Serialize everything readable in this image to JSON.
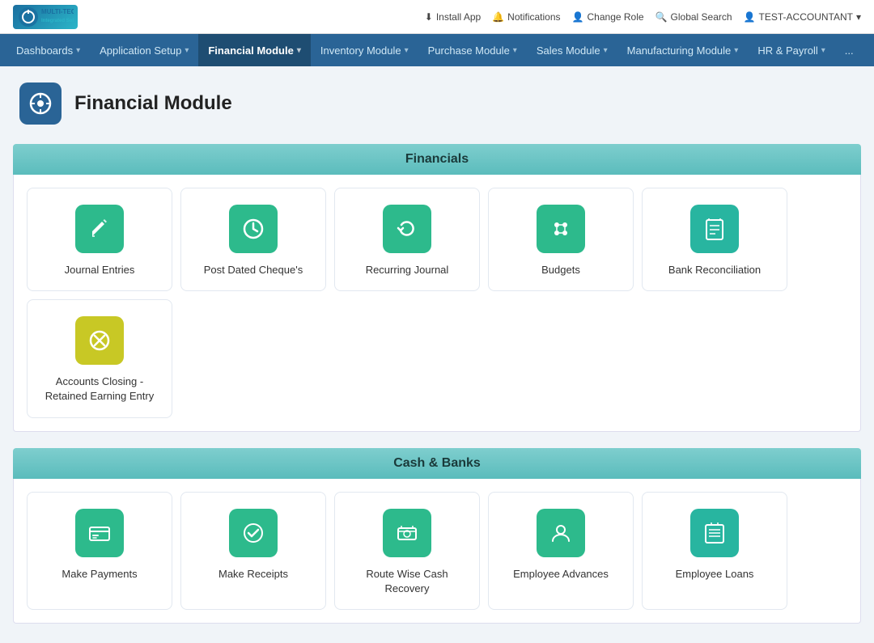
{
  "topbar": {
    "logo_text": "MULTI-TECHNO\nIntegrated Solutions",
    "actions": [
      {
        "id": "install-app",
        "label": "Install App",
        "icon": "⬇"
      },
      {
        "id": "notifications",
        "label": "Notifications",
        "icon": "🔔"
      },
      {
        "id": "change-role",
        "label": "Change Role",
        "icon": "👤"
      },
      {
        "id": "global-search",
        "label": "Global Search",
        "icon": "🔍"
      },
      {
        "id": "user",
        "label": "TEST-ACCOUNTANT",
        "icon": "👤"
      }
    ]
  },
  "navbar": {
    "items": [
      {
        "id": "dashboards",
        "label": "Dashboards",
        "active": false
      },
      {
        "id": "application-setup",
        "label": "Application Setup",
        "active": false
      },
      {
        "id": "financial-module",
        "label": "Financial Module",
        "active": true
      },
      {
        "id": "inventory-module",
        "label": "Inventory Module",
        "active": false
      },
      {
        "id": "purchase-module",
        "label": "Purchase Module",
        "active": false
      },
      {
        "id": "sales-module",
        "label": "Sales Module",
        "active": false
      },
      {
        "id": "manufacturing-module",
        "label": "Manufacturing Module",
        "active": false
      },
      {
        "id": "hr-payroll",
        "label": "HR & Payroll",
        "active": false
      },
      {
        "id": "more",
        "label": "...",
        "active": false
      }
    ]
  },
  "page": {
    "title": "Financial Module",
    "icon": "⚙"
  },
  "sections": [
    {
      "id": "financials",
      "label": "Financials",
      "cards": [
        {
          "id": "journal-entries",
          "label": "Journal Entries",
          "icon": "✏",
          "icon_class": "icon-teal"
        },
        {
          "id": "post-dated-cheques",
          "label": "Post Dated Cheque's",
          "icon": "🕐",
          "icon_class": "icon-teal"
        },
        {
          "id": "recurring-journal",
          "label": "Recurring Journal",
          "icon": "♻",
          "icon_class": "icon-teal"
        },
        {
          "id": "budgets",
          "label": "Budgets",
          "icon": "⚏",
          "icon_class": "icon-teal"
        },
        {
          "id": "bank-reconciliation",
          "label": "Bank Reconciliation",
          "icon": "📄",
          "icon_class": "icon-green-teal"
        },
        {
          "id": "accounts-closing",
          "label": "Accounts Closing - Retained Earning Entry",
          "icon": "⊗",
          "icon_class": "icon-yellow"
        }
      ]
    },
    {
      "id": "cash-banks",
      "label": "Cash & Banks",
      "cards": [
        {
          "id": "make-payments",
          "label": "Make Payments",
          "icon": "💳",
          "icon_class": "icon-teal"
        },
        {
          "id": "make-receipts",
          "label": "Make Receipts",
          "icon": "✅",
          "icon_class": "icon-teal"
        },
        {
          "id": "route-wise-cash-recovery",
          "label": "Route Wise Cash Recovery",
          "icon": "💵",
          "icon_class": "icon-teal"
        },
        {
          "id": "employee-advances",
          "label": "Employee Advances",
          "icon": "👤",
          "icon_class": "icon-teal"
        },
        {
          "id": "employee-loans",
          "label": "Employee Loans",
          "icon": "📖",
          "icon_class": "icon-green-teal"
        }
      ]
    }
  ]
}
